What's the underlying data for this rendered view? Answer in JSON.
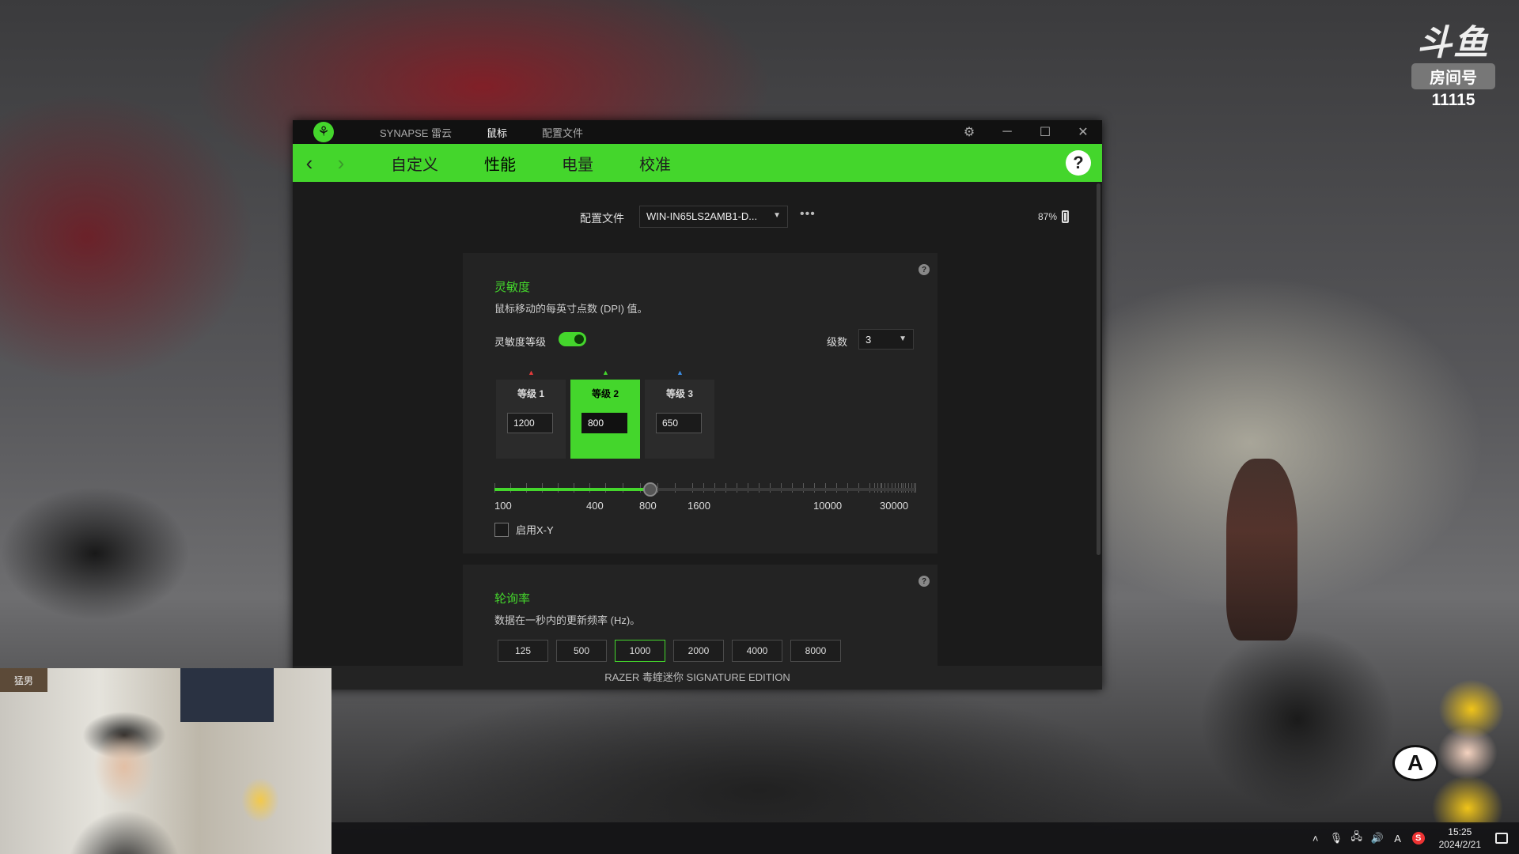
{
  "overlay": {
    "brand": "斗鱼",
    "room_label": "房间号",
    "room_number": "11115"
  },
  "titlebar": {
    "items": [
      "SYNAPSE 雷云",
      "鼠标",
      "配置文件"
    ]
  },
  "nav": {
    "tabs": [
      "自定义",
      "性能",
      "电量",
      "校准"
    ],
    "help": "?"
  },
  "profile": {
    "label": "配置文件",
    "value": "WIN-IN65LS2AMB1-D...",
    "more": "•••"
  },
  "battery": {
    "percent": "87%"
  },
  "sensitivity": {
    "title": "灵敏度",
    "description": "鼠标移动的每英寸点数 (DPI) 值。",
    "toggle_label": "灵敏度等级",
    "toggle_on": true,
    "levels_label": "级数",
    "levels_value": "3",
    "stages": [
      {
        "name": "等级 1",
        "value": "1200",
        "color": "#e33b3b"
      },
      {
        "name": "等级 2",
        "value": "800",
        "color": "#44d62c"
      },
      {
        "name": "等级 3",
        "value": "650",
        "color": "#3b8ce3"
      }
    ],
    "active_stage": 2,
    "slider_fraction": 0.37,
    "scale_labels": [
      "100",
      "400",
      "800",
      "1600",
      "10000",
      "30000"
    ],
    "xy_label": "启用X-Y",
    "xy_enabled": false
  },
  "polling": {
    "title": "轮询率",
    "description": "数据在一秒内的更新频率 (Hz)。",
    "rates": [
      "125",
      "500",
      "1000",
      "2000",
      "4000",
      "8000"
    ],
    "selected": "1000"
  },
  "statusbar": {
    "device": "RAZER 毒蝰迷你 SIGNATURE EDITION"
  },
  "webcam": {
    "sign": "猛男"
  },
  "mascot": {
    "letter": "A"
  },
  "taskbar": {
    "ime": "A",
    "sogou": "S",
    "time": "15:25",
    "date": "2024/2/21"
  },
  "colors": {
    "accent": "#44d62c",
    "background": "#1b1b1b"
  }
}
